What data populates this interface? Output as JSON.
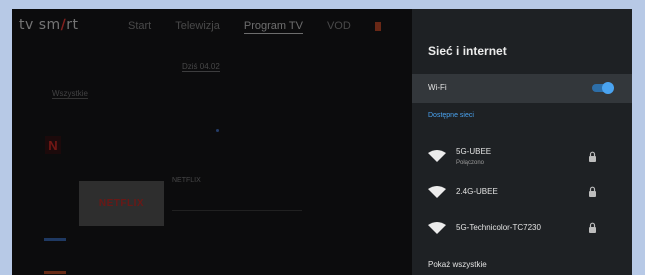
{
  "app": {
    "logo": {
      "text_left": "tv sm",
      "accent": "∕",
      "text_right": "rt"
    },
    "nav": [
      "Start",
      "Telewizja",
      "Program TV",
      "VOD"
    ],
    "nav_active_index": 2,
    "date_chip": "Dziś 04.02",
    "filter_label": "Wszystkie",
    "channel_logo": "N",
    "program_tile": "NETFLIX",
    "program_title": "NETFLIX"
  },
  "panel": {
    "title": "Sieć i internet",
    "wifi_label": "Wi-Fi",
    "wifi_enabled": true,
    "section_label": "Dostępne sieci",
    "networks": [
      {
        "name": "5G-UBEE",
        "status": "Połączono",
        "icon": "wifi-icon",
        "secured": true
      },
      {
        "name": "2.4G-UBEE",
        "status": "",
        "icon": "wifi-icon",
        "secured": true
      },
      {
        "name": "5G-Technicolor-TC7230",
        "status": "",
        "icon": "wifi-icon",
        "secured": true
      }
    ],
    "show_all": "Pokaż wszystkie"
  },
  "colors": {
    "accent": "#4aa3f0",
    "panel_bg": "#1e2124",
    "selected_row": "#33373b",
    "brand_red": "#e5322d"
  }
}
